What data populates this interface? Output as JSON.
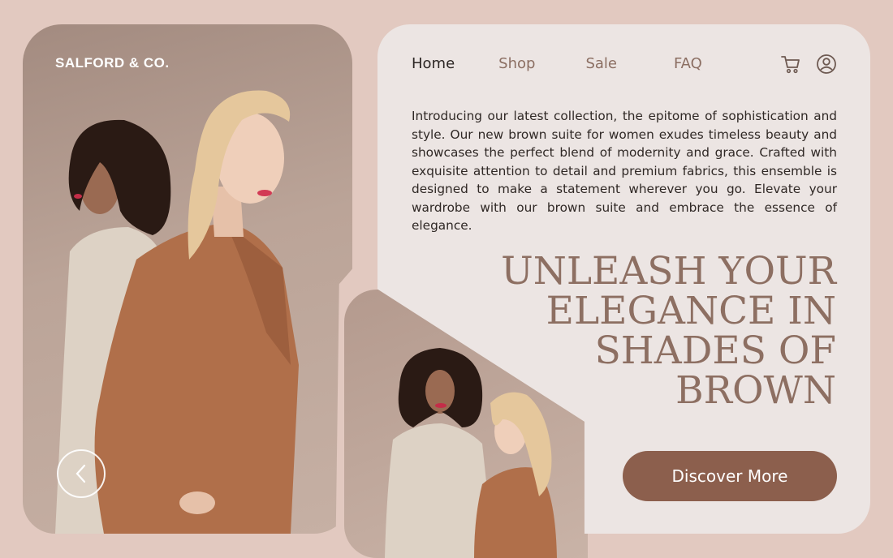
{
  "brand": {
    "name": "SALFORD & CO."
  },
  "nav": {
    "items": [
      {
        "label": "Home",
        "active": true
      },
      {
        "label": "Shop",
        "active": false
      },
      {
        "label": "Sale",
        "active": false
      },
      {
        "label": "FAQ",
        "active": false
      }
    ],
    "icons": [
      "cart-icon",
      "user-account-icon"
    ]
  },
  "intro": {
    "text": "Introducing our latest collection, the epitome of sophistication and style. Our new brown suite for women exudes timeless beauty and showcases the perfect blend of modernity and grace. Crafted with exquisite attention to detail and premium fabrics, this ensemble is designed to make a statement wherever you go. Elevate your wardrobe with our brown suite and embrace the essence of elegance."
  },
  "headline": {
    "text": "UNLEASH YOUR ELEGANCE IN SHADES OF BROWN"
  },
  "cta": {
    "label": "Discover More"
  },
  "carousel": {
    "prev_icon": "chevron-left-icon"
  },
  "colors": {
    "page_background": "#e2c9c0",
    "card_background": "#ece5e3",
    "accent": "#8c5f4d",
    "headline": "#8d6f62",
    "nav_inactive": "#8b6e62"
  }
}
